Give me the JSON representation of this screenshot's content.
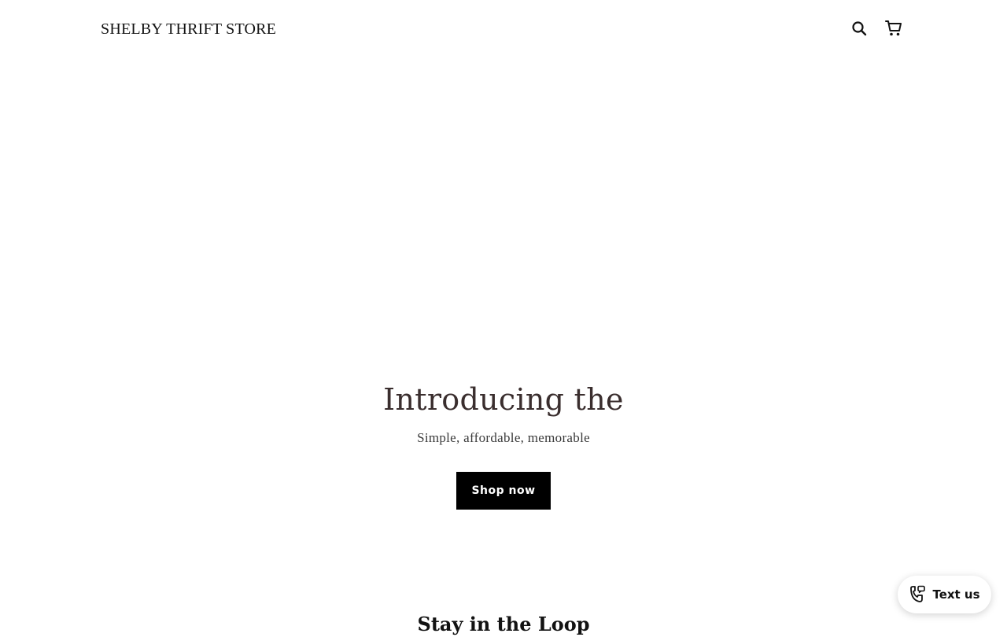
{
  "header": {
    "logo_text": "SHELBY THRIFT STORE",
    "icons": [
      "search-icon",
      "cart-icon"
    ]
  },
  "hero": {
    "title": "Introducing the",
    "subtitle": "Simple, affordable, memorable",
    "button_label": "Shop now"
  },
  "newsletter": {
    "heading": "Stay in the Loop"
  },
  "chat_widget": {
    "label": "Text us",
    "icon": "phone-message-icon"
  },
  "colors": {
    "button_bg": "#000000",
    "button_text": "#ffffff",
    "title_text": "#3a2e2e"
  }
}
